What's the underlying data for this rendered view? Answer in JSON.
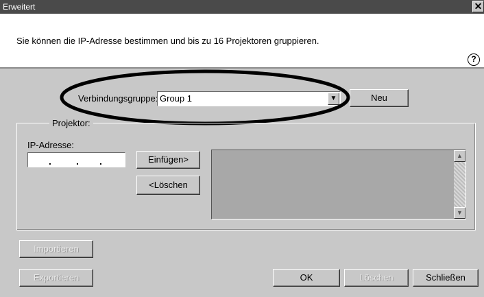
{
  "window": {
    "title": "Erweitert",
    "close_icon": "close-icon"
  },
  "header": {
    "intro": "Sie können die IP-Adresse bestimmen und bis zu 16 Projektoren gruppieren.",
    "help_glyph": "?"
  },
  "connection": {
    "label": "Verbindungsgruppe:",
    "selected": "Group 1",
    "new_button": "Neu"
  },
  "projector": {
    "group_title": "Projektor:",
    "ip_label": "IP-Adresse:",
    "ip_value": ". . .",
    "insert_button": "Einfügen>",
    "delete_button": "<Löschen"
  },
  "bottom": {
    "import_button": "Importieren",
    "export_button": "Exportieren",
    "ok_button": "OK",
    "delete_button": "Löschen",
    "close_button": "Schließen"
  }
}
